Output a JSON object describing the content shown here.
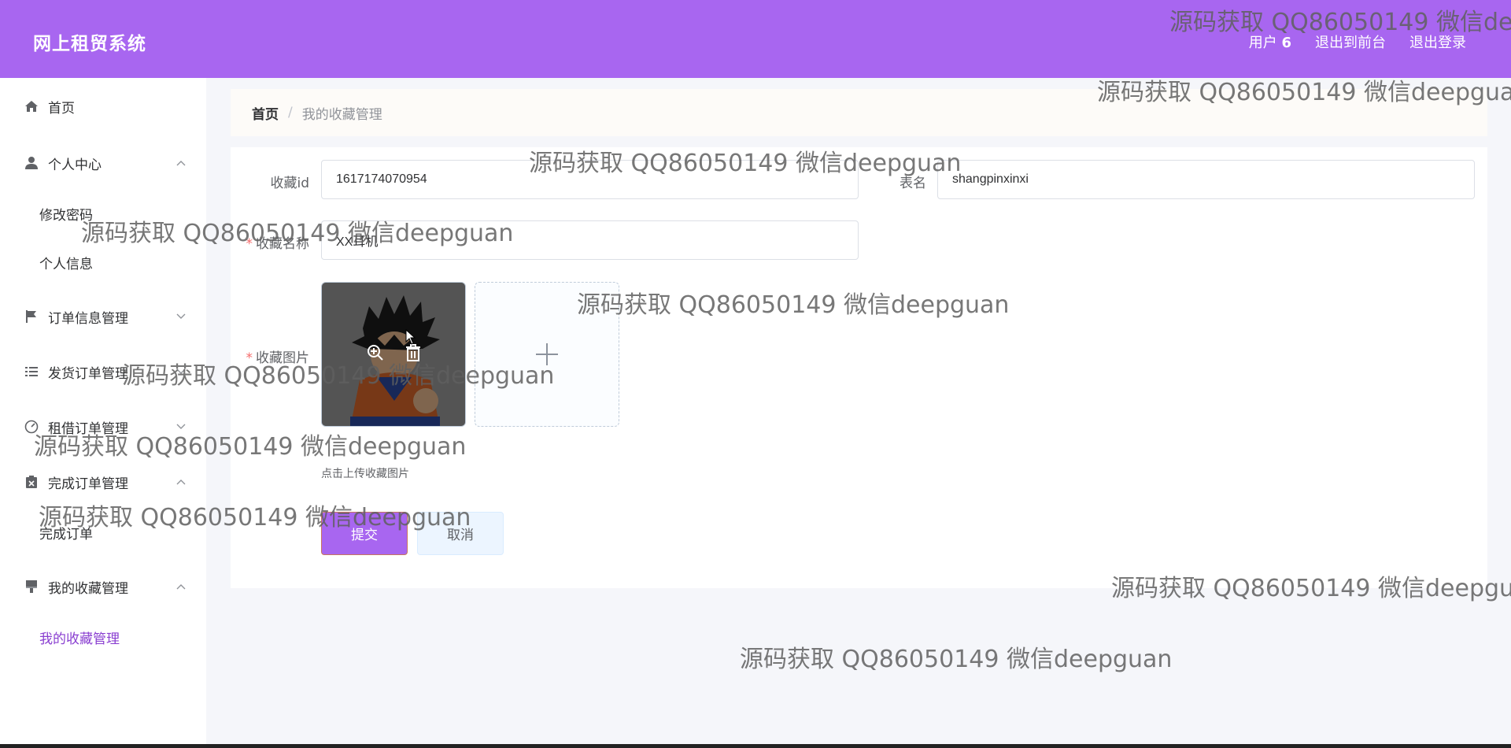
{
  "header": {
    "app_title": "网上租贸系统",
    "user_label": "用户",
    "user_id": "6",
    "back_to_front": "退出到前台",
    "logout": "退出登录"
  },
  "sidebar": {
    "items": [
      {
        "label": "首页",
        "icon": "home-icon"
      },
      {
        "label": "个人中心",
        "icon": "user-icon",
        "expanded": true,
        "children": [
          "修改密码",
          "个人信息"
        ]
      },
      {
        "label": "订单信息管理",
        "icon": "flag-icon",
        "expanded": false
      },
      {
        "label": "发货订单管理",
        "icon": "list-icon",
        "expanded": false
      },
      {
        "label": "租借订单管理",
        "icon": "gauge-icon",
        "expanded": false
      },
      {
        "label": "完成订单管理",
        "icon": "clipboard-icon",
        "expanded": true,
        "children": [
          "完成订单"
        ]
      },
      {
        "label": "我的收藏管理",
        "icon": "brush-icon",
        "expanded": true,
        "children": [
          "我的收藏管理"
        ]
      }
    ]
  },
  "breadcrumb": {
    "home": "首页",
    "separator": "/",
    "current": "我的收藏管理"
  },
  "form": {
    "fav_id_label": "收藏id",
    "fav_id_value": "1617174070954",
    "table_name_label": "表名",
    "table_name_value": "shangpinxinxi",
    "fav_name_label": "收藏名称",
    "fav_name_value": "XX耳机",
    "fav_image_label": "收藏图片",
    "required_mark": "*",
    "upload_tip": "点击上传收藏图片",
    "submit_label": "提交",
    "cancel_label": "取消"
  },
  "watermark": {
    "text": "源码获取 QQ86050149 微信deepguan"
  },
  "colors": {
    "accent": "#a866f0",
    "active_menu": "#8a3fd1",
    "required": "#f56c6c"
  }
}
